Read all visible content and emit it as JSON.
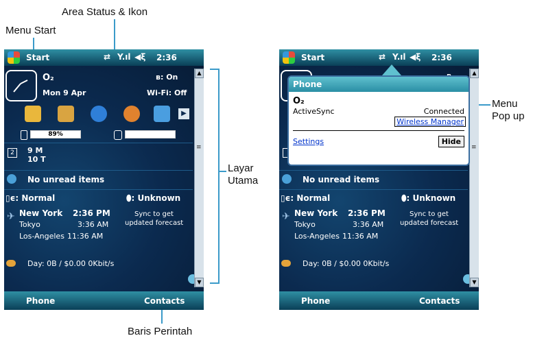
{
  "annotations": {
    "area_status": "Area Status & Ikon",
    "menu_start": "Menu Start",
    "layar_utama_1": "Layar",
    "layar_utama_2": "Utama",
    "menu_popup_1": "Menu",
    "menu_popup_2": "Pop up",
    "baris_perintah": "Baris Perintah"
  },
  "phone": {
    "start_label": "Start",
    "time": "2:36",
    "operator": "O₂",
    "date": "Mon 9 Apr",
    "bluetooth": ": On",
    "wifi": "Wi-Fi: Off",
    "battery": "89%",
    "calendar_1": "9 M",
    "calendar_2": "10 T",
    "messages": "No unread items",
    "profile": ": Normal",
    "network": ": Unknown",
    "weather": [
      {
        "city": "New York",
        "time": "2:36 PM"
      },
      {
        "city": "Tokyo",
        "time": "3:36 AM"
      },
      {
        "city": "Los-Angeles",
        "time": "11:36 AM"
      }
    ],
    "sync_1": "Sync to get",
    "sync_2": "updated forecast",
    "usage": "Day: 0B / $0.00  0Kbit/s",
    "softkey_left": "Phone",
    "softkey_right": "Contacts"
  },
  "popup": {
    "title": "Phone",
    "operator": "O₂",
    "activesync_label": "ActiveSync",
    "activesync_value": "Connected",
    "wireless_manager": "Wireless Manager",
    "settings": "Settings",
    "hide": "Hide"
  },
  "colors": {
    "accent_line": "#3a9ac9",
    "bar_top": "#2f8fa3",
    "screen_bg": "#0b2a4f"
  }
}
